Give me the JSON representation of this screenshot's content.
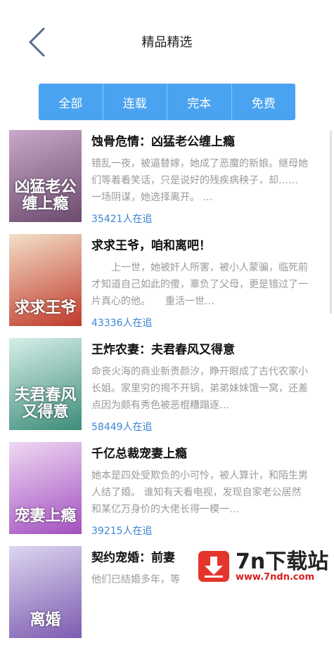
{
  "header": {
    "title": "精品精选"
  },
  "tabs": [
    {
      "label": "全部"
    },
    {
      "label": "连载"
    },
    {
      "label": "完本"
    },
    {
      "label": "免费"
    }
  ],
  "books": [
    {
      "title": "蚀骨危情：凶猛老公缠上瘾",
      "description": "错乱一夜，被逼替嫁，她成了恶魔的新娘。继母她们等着看笑话，只是说好的残疾病秧子，却…… 一场阴谋，她选择离开。 …",
      "followers": "35421人在追",
      "cover_text": "凶猛老公缠上瘾",
      "cover_colors": [
        "#c9a9c9",
        "#6b4a6e"
      ]
    },
    {
      "title": "求求王爷，咱和离吧！",
      "description": "　　上一世，她被奸人所害，被小人蒙骗，临死前才知道自己如此的傻，辜负了父母，更是错过了一片真心的他。　　重活一世…",
      "followers": "43336人在追",
      "cover_text": "求求王爷",
      "cover_colors": [
        "#f3e0c8",
        "#c0392b"
      ]
    },
    {
      "title": "王炸农妻：夫君春风又得意",
      "description": "命丧火海的商业新贵颜汐，睁开眼成了古代农家小长姐。家里穷的揭不开锅，弟弟妹妹饿一窝，还差点因为颇有秀色被恶棍糟蹋逐…",
      "followers": "58449人在追",
      "cover_text": "夫君春风又得意",
      "cover_colors": [
        "#d7efe9",
        "#3d8c7a"
      ]
    },
    {
      "title": "千亿总裁宠妻上瘾",
      "description": "她本是四处受欺负的小可怜，被人算计，和陌生男人结了婚。 谁知有天看电视，发现自家老公居然和某亿万身价的大佬长得一模一…",
      "followers": "39215人在追",
      "cover_text": "宠妻上瘾",
      "cover_colors": [
        "#efd9f3",
        "#a34fc0"
      ]
    },
    {
      "title": "契约宠婚：前妻",
      "description": "他们已结婚多年，等",
      "followers": "",
      "cover_text": "离婚",
      "cover_colors": [
        "#ddd6f0",
        "#7d5bb0"
      ]
    }
  ],
  "watermark": {
    "title": "7n下载站",
    "url": "www.7ndn.com"
  }
}
